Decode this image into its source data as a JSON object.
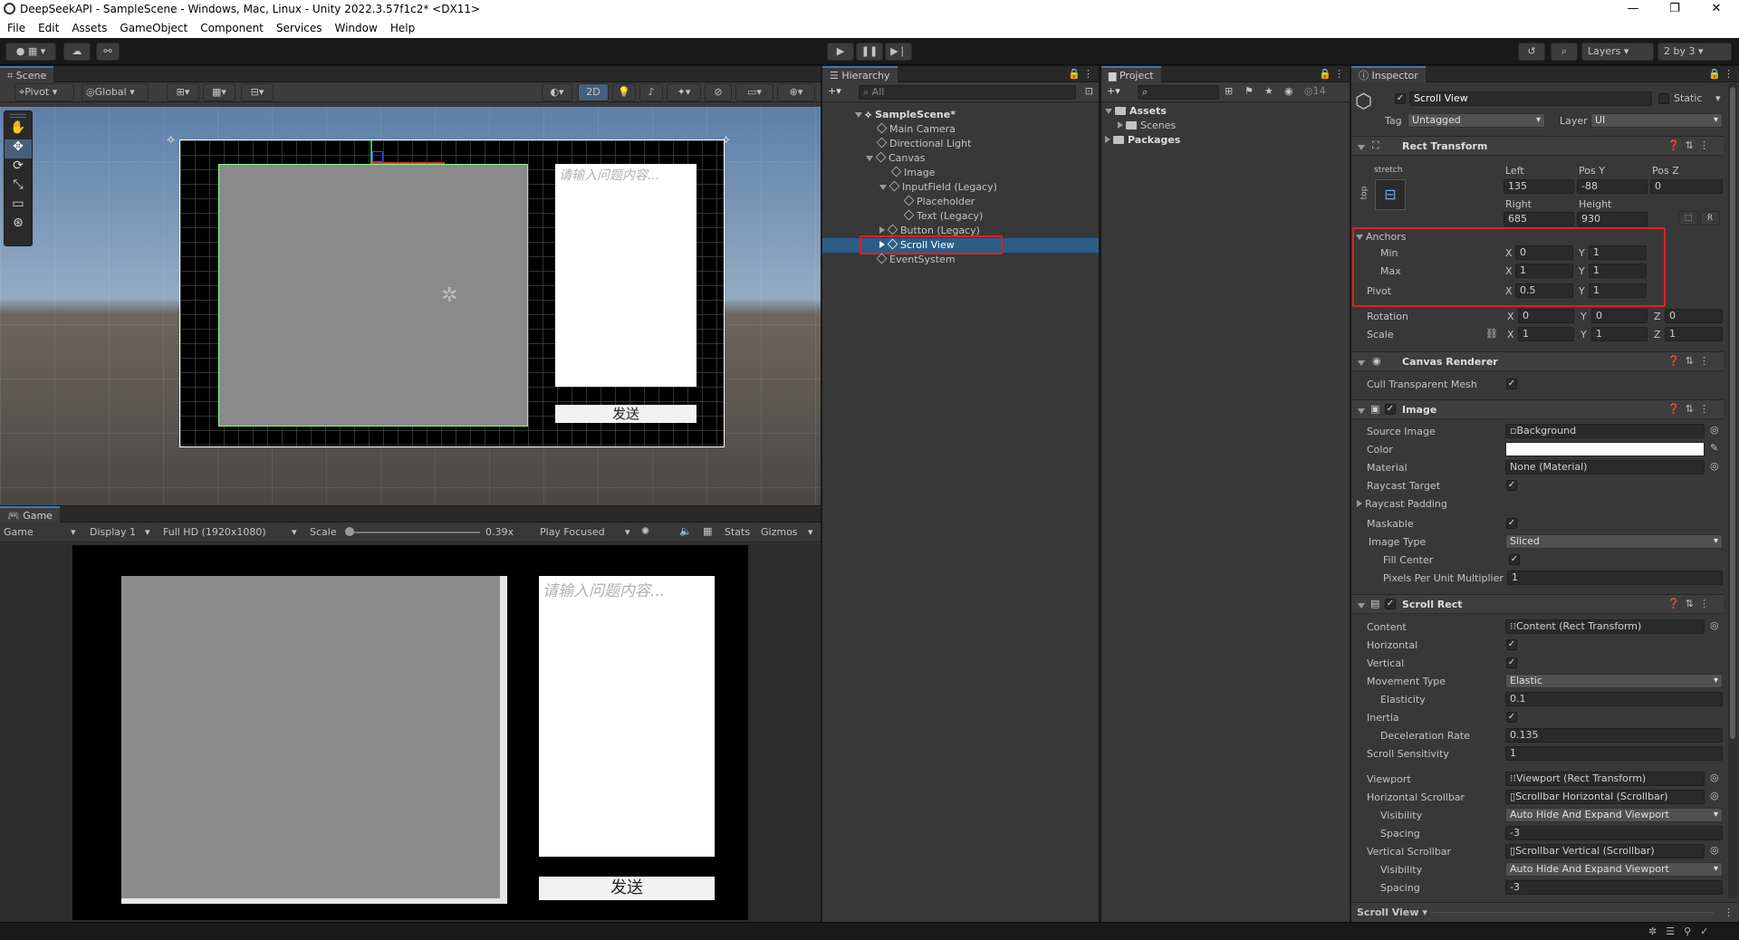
{
  "window": {
    "title": "DeepSeekAPI - SampleScene - Windows, Mac, Linux - Unity 2022.3.57f1c2* <DX11>",
    "controls": [
      "—",
      "❐",
      "✕"
    ]
  },
  "menu": [
    "File",
    "Edit",
    "Assets",
    "GameObject",
    "Component",
    "Services",
    "Window",
    "Help"
  ],
  "toolbar": {
    "layers": "Layers",
    "layout": "2 by 3"
  },
  "scene": {
    "tab": "Scene",
    "pivot": "Pivot",
    "global": "Global",
    "mode2d": "2D",
    "ui_placeholder": "请输入问题内容...",
    "ui_send": "发送"
  },
  "game": {
    "tab": "Game",
    "mode": "Game",
    "display": "Display 1",
    "resolution": "Full HD (1920x1080)",
    "scale_label": "Scale",
    "scale_value": "0.39x",
    "play_focused": "Play Focused",
    "stats": "Stats",
    "gizmos": "Gizmos",
    "ui_placeholder": "请输入问题内容...",
    "ui_send": "发送"
  },
  "hierarchy": {
    "tab": "Hierarchy",
    "search_placeholder": "All",
    "items": [
      {
        "label": "SampleScene*"
      },
      {
        "label": "Main Camera"
      },
      {
        "label": "Directional Light"
      },
      {
        "label": "Canvas"
      },
      {
        "label": "Image"
      },
      {
        "label": "InputField (Legacy)"
      },
      {
        "label": "Placeholder"
      },
      {
        "label": "Text (Legacy)"
      },
      {
        "label": "Button (Legacy)"
      },
      {
        "label": "Scroll View"
      },
      {
        "label": "EventSystem"
      }
    ]
  },
  "project": {
    "tab": "Project",
    "hidden_count": "14",
    "items": [
      {
        "label": "Assets"
      },
      {
        "label": "Scenes"
      },
      {
        "label": "Packages"
      }
    ]
  },
  "inspector": {
    "tab": "Inspector",
    "object_name": "Scroll View",
    "static_label": "Static",
    "tag_label": "Tag",
    "tag_value": "Untagged",
    "layer_label": "Layer",
    "layer_value": "UI",
    "rect_transform": {
      "title": "Rect Transform",
      "stretch": "stretch",
      "top": "top",
      "left_label": "Left",
      "left": "135",
      "posy_label": "Pos Y",
      "posy": "-88",
      "posz_label": "Pos Z",
      "posz": "0",
      "right_label": "Right",
      "right": "685",
      "height_label": "Height",
      "height": "930",
      "r_button": "R",
      "anchors_label": "Anchors",
      "min_label": "Min",
      "min_x": "0",
      "min_y": "1",
      "max_label": "Max",
      "max_x": "1",
      "max_y": "1",
      "pivot_label": "Pivot",
      "pivot_x": "0.5",
      "pivot_y": "1",
      "rotation_label": "Rotation",
      "rot_x": "0",
      "rot_y": "0",
      "rot_z": "0",
      "scale_label": "Scale",
      "scale_x": "1",
      "scale_y": "1",
      "scale_z": "1",
      "x": "X",
      "y": "Y",
      "z": "Z"
    },
    "canvas_renderer": {
      "title": "Canvas Renderer",
      "cull_label": "Cull Transparent Mesh"
    },
    "image": {
      "title": "Image",
      "source_label": "Source Image",
      "source": "Background",
      "color_label": "Color",
      "material_label": "Material",
      "material": "None (Material)",
      "raycast_target": "Raycast Target",
      "raycast_padding": "Raycast Padding",
      "maskable": "Maskable",
      "image_type_label": "Image Type",
      "image_type": "Sliced",
      "fill_center": "Fill Center",
      "ppu_label": "Pixels Per Unit Multiplier",
      "ppu": "1"
    },
    "scroll_rect": {
      "title": "Scroll Rect",
      "content_label": "Content",
      "content": "Content (Rect Transform)",
      "horizontal": "Horizontal",
      "vertical": "Vertical",
      "movement_label": "Movement Type",
      "movement": "Elastic",
      "elasticity_label": "Elasticity",
      "elasticity": "0.1",
      "inertia": "Inertia",
      "decel_label": "Deceleration Rate",
      "decel": "0.135",
      "sensitivity_label": "Scroll Sensitivity",
      "sensitivity": "1",
      "viewport_label": "Viewport",
      "viewport": "Viewport (Rect Transform)",
      "hscroll_label": "Horizontal Scrollbar",
      "hscroll": "Scrollbar Horizontal (Scrollbar)",
      "visibility_label": "Visibility",
      "hvis": "Auto Hide And Expand Viewport",
      "spacing_label": "Spacing",
      "hspacing": "-3",
      "vscroll_label": "Vertical Scrollbar",
      "vscroll": "Scrollbar Vertical (Scrollbar)",
      "vvis": "Auto Hide And Expand Viewport",
      "vspacing": "-3"
    },
    "footer": "Scroll View"
  },
  "colors": {
    "accent": "#2c5d87",
    "highlight": "#e02020",
    "panel": "#383838"
  }
}
